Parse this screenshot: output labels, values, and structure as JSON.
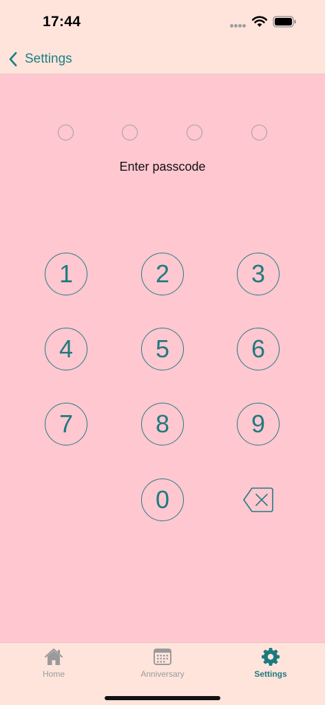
{
  "status_bar": {
    "time": "17:44"
  },
  "nav": {
    "back_label": "Settings"
  },
  "passcode": {
    "prompt": "Enter passcode",
    "keys": [
      "1",
      "2",
      "3",
      "4",
      "5",
      "6",
      "7",
      "8",
      "9",
      "0"
    ]
  },
  "tabs": [
    {
      "label": "Home",
      "icon": "house-icon"
    },
    {
      "label": "Anniversary",
      "icon": "calendar-icon"
    },
    {
      "label": "Settings",
      "icon": "gear-icon"
    }
  ],
  "colors": {
    "accent": "#1b8080",
    "keypad": "#1e7b80",
    "background": "#ffc7d0",
    "bar_background": "#ffe4dc",
    "inactive_tab": "#9a9a9a"
  }
}
